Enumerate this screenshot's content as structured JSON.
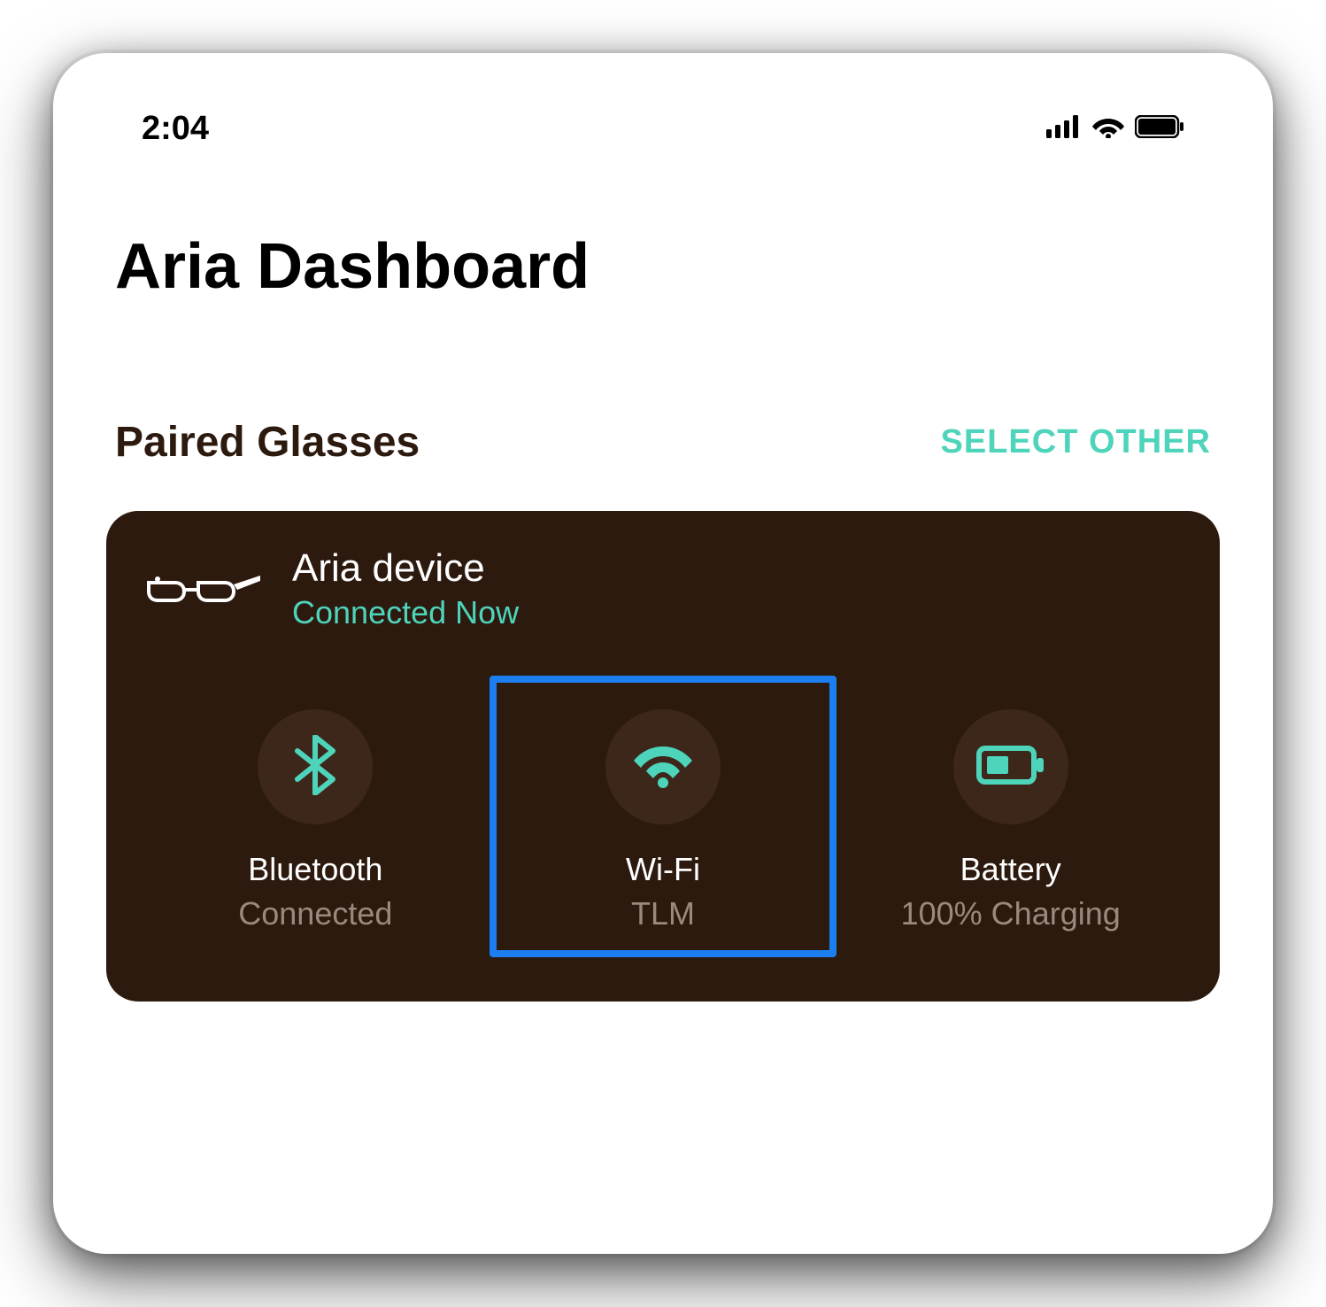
{
  "statusBar": {
    "time": "2:04"
  },
  "header": {
    "title": "Aria Dashboard"
  },
  "section": {
    "title": "Paired Glasses",
    "selectOther": "SELECT OTHER"
  },
  "device": {
    "name": "Aria device",
    "status": "Connected Now"
  },
  "tiles": [
    {
      "label": "Bluetooth",
      "value": "Connected",
      "icon": "bluetooth",
      "selected": false
    },
    {
      "label": "Wi-Fi",
      "value": "TLM",
      "icon": "wifi",
      "selected": true
    },
    {
      "label": "Battery",
      "value": "100% Charging",
      "icon": "battery",
      "selected": false
    }
  ],
  "colors": {
    "accent": "#4ed4bb",
    "cardBg": "#2d1a0f",
    "highlight": "#1c7ef0"
  }
}
